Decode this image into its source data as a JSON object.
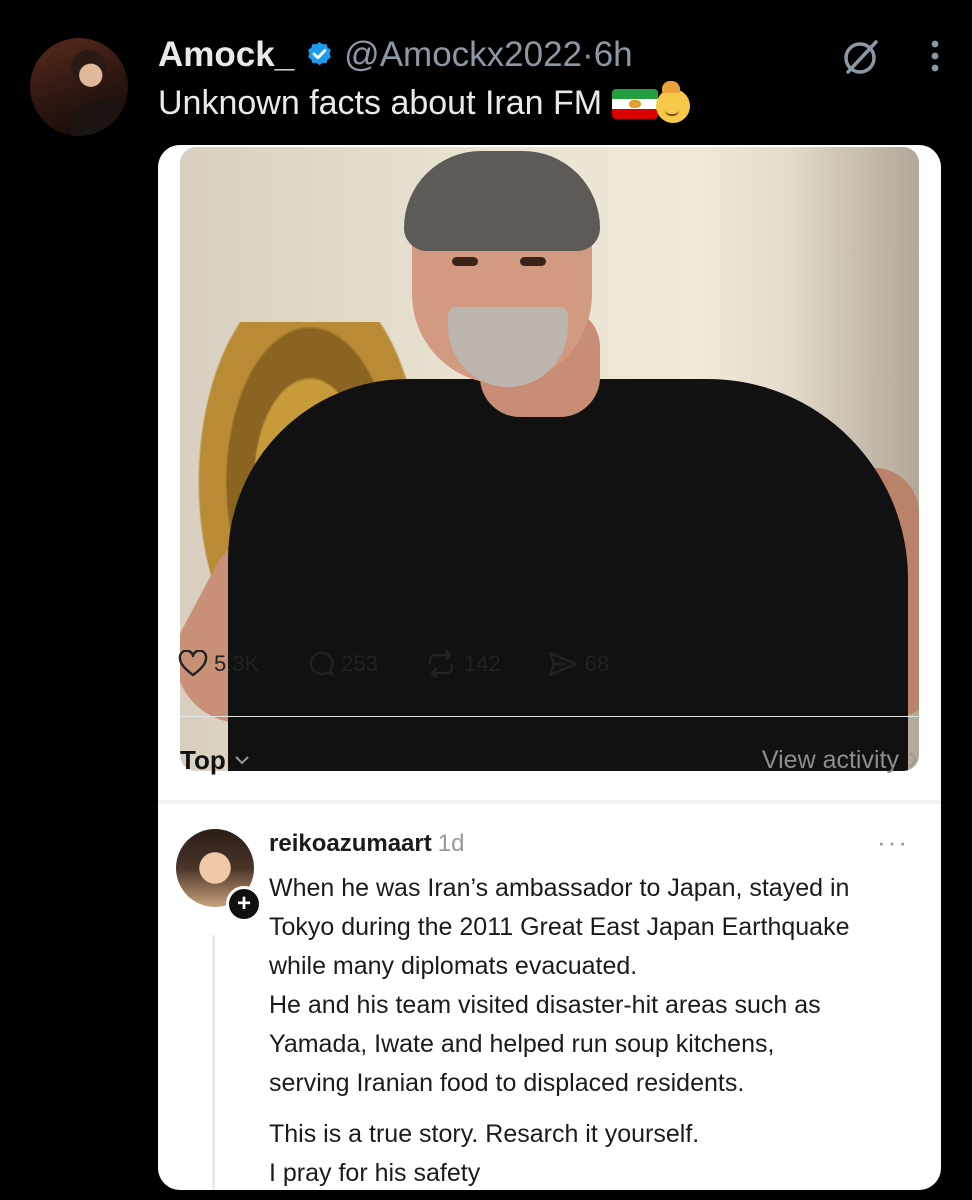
{
  "tweet": {
    "author_name": "Amock_",
    "author_handle": "@Amockx2022",
    "separator": " · ",
    "time_ago": "6h",
    "text": "Unknown facts about Iran FM",
    "emoji_icons": [
      "iran-lion-sun-flag-icon",
      "saluting-face-emoji-icon"
    ],
    "verified": true,
    "accent": "#1d9bf0"
  },
  "embed": {
    "stats": [
      {
        "icon": "heart-icon",
        "value": "5.3K"
      },
      {
        "icon": "comment-icon",
        "value": "253"
      },
      {
        "icon": "repost-icon",
        "value": "142"
      },
      {
        "icon": "share-icon",
        "value": "68"
      }
    ],
    "sort_label": "Top",
    "view_activity": "View activity",
    "comment": {
      "username": "reikoazumaart",
      "time": "1d",
      "more": "···",
      "lines": [
        "When he was Iran’s ambassador to Japan, stayed in",
        "Tokyo during the 2011 Great East Japan Earthquake",
        "while many diplomats evacuated.",
        "He and his team visited disaster-hit areas such as",
        "Yamada, Iwate and helped run soup kitchens,",
        "serving Iranian food to displaced residents."
      ],
      "lines2": [
        "This is a true story.  Resarch it yourself.",
        "I pray for his safety"
      ]
    }
  }
}
